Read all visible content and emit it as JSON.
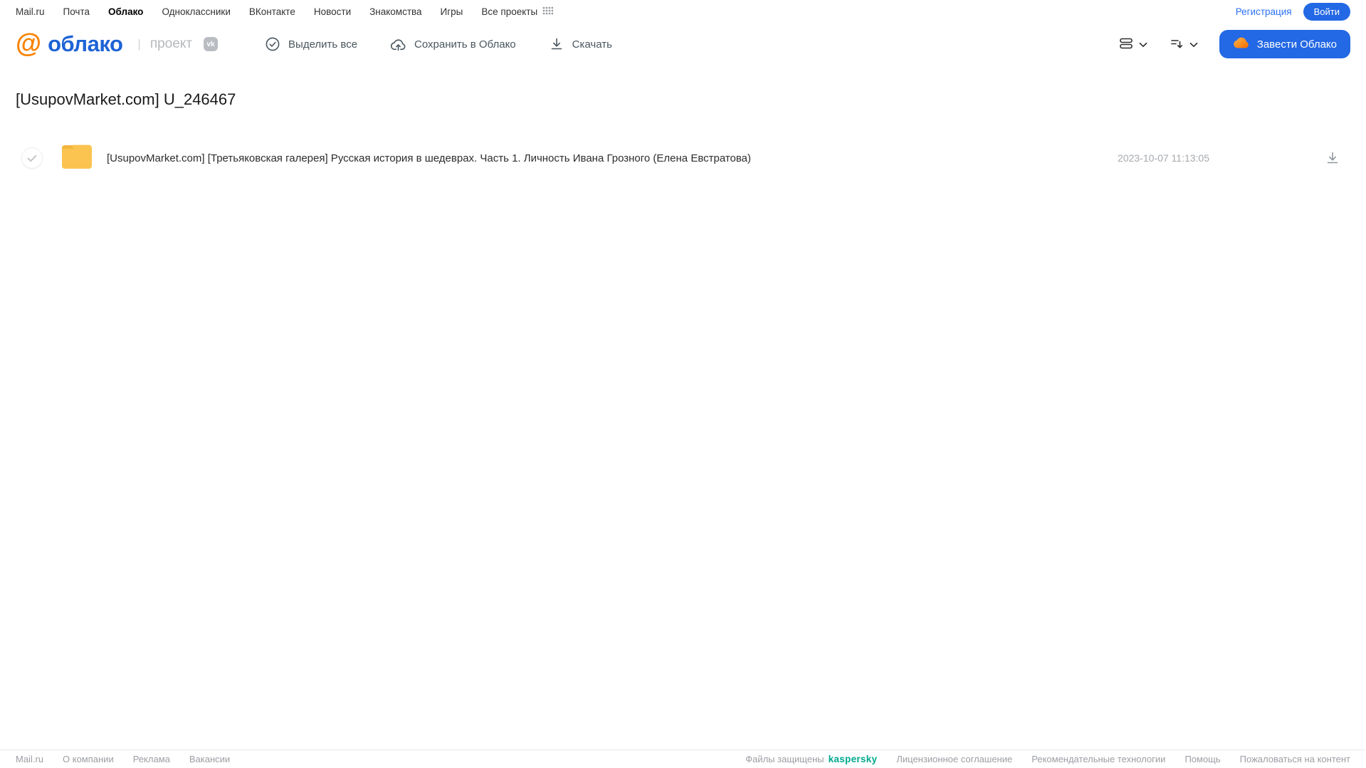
{
  "topnav": {
    "links": [
      "Mail.ru",
      "Почта",
      "Облако",
      "Одноклассники",
      "ВКонтакте",
      "Новости",
      "Знакомства",
      "Игры",
      "Все проекты"
    ],
    "register_label": "Регистрация",
    "login_label": "Войти"
  },
  "header": {
    "logo_at": "@",
    "logo_text": "облако",
    "logo_divider": "|",
    "project_label": "проект",
    "vk_badge": "vk",
    "toolbar": {
      "select_all_label": "Выделить все",
      "save_to_cloud_label": "Сохранить в Облако",
      "download_label": "Скачать"
    },
    "get_cloud_label": "Завести Облако"
  },
  "page": {
    "title": "[UsupovMarket.com] U_246467"
  },
  "files": [
    {
      "name": "[UsupovMarket.com] [Третьяковская галерея] Русская история в шедеврах. Часть 1. Личность Ивана Грозного (Елена Евстратова)",
      "date": "2023-10-07 11:13:05"
    }
  ],
  "footer": {
    "left_links": [
      "Mail.ru",
      "О компании",
      "Реклама",
      "Вакансии"
    ],
    "protected_label": "Файлы защищены",
    "kaspersky_label": "kaspersky",
    "right_links": [
      "Лицензионное соглашение",
      "Рекомендательные технологии",
      "Помощь",
      "Пожаловаться на контент"
    ]
  },
  "colors": {
    "accent_blue": "#2368e4",
    "logo_blue": "#1e63d6",
    "logo_orange": "#f98302",
    "folder_yellow": "#fbc34f",
    "kaspersky_teal": "#00a88e"
  }
}
